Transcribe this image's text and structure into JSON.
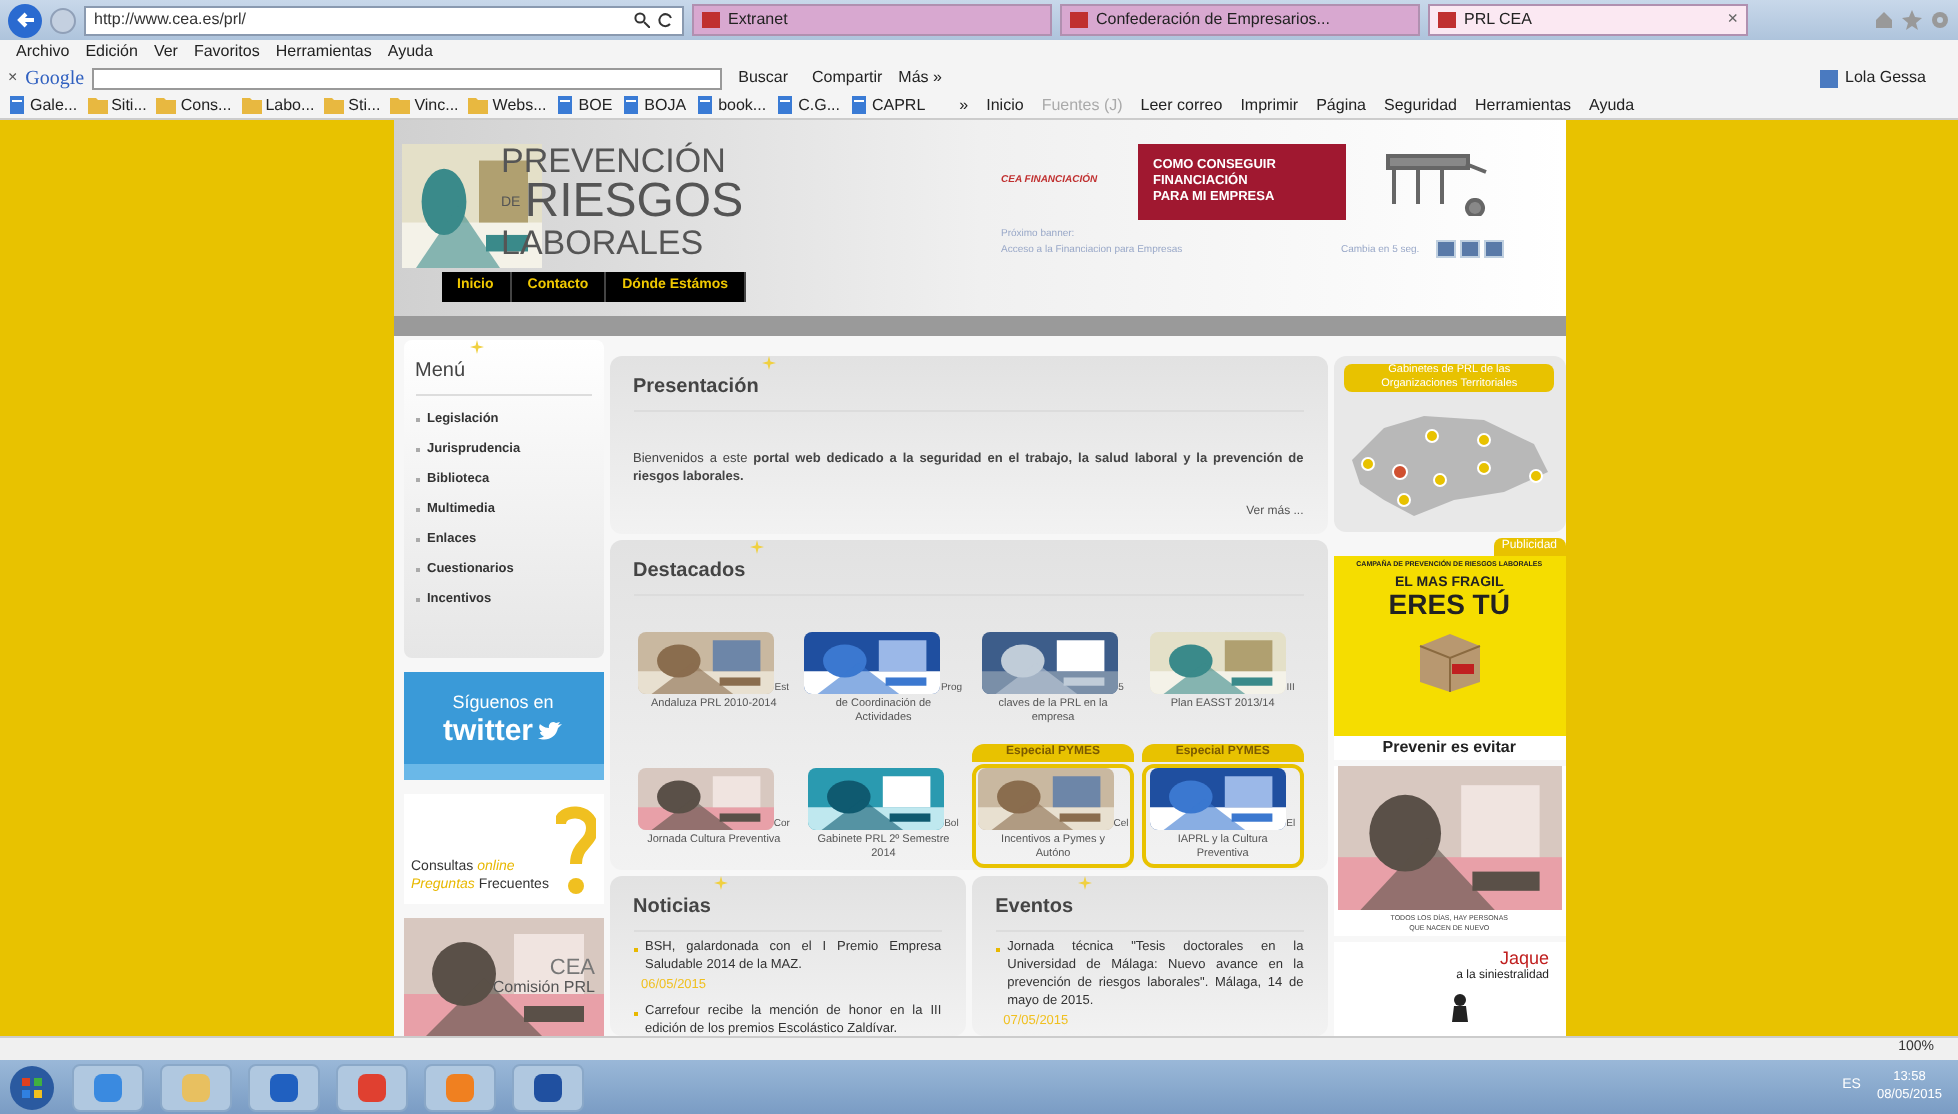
{
  "browser": {
    "address": "http://www.cea.es/prl/",
    "tabs": [
      {
        "label": "Extranet",
        "selected": false
      },
      {
        "label": "Confederación de Empresarios...",
        "selected": false
      },
      {
        "label": "PRL CEA",
        "selected": true,
        "close": "×"
      }
    ],
    "menu": [
      "Archivo",
      "Edición",
      "Ver",
      "Favoritos",
      "Herramientas",
      "Ayuda"
    ],
    "google_toolbar": {
      "close": "×",
      "logo": "Google",
      "buttons": [
        "Buscar",
        "Compartir"
      ],
      "more": "Más »",
      "user": "Lola Gessa"
    },
    "favorites": [
      {
        "label": "Gale...",
        "kind": "page"
      },
      {
        "label": "Siti...",
        "kind": "folder"
      },
      {
        "label": "Cons...",
        "kind": "folder"
      },
      {
        "label": "Labo...",
        "kind": "folder"
      },
      {
        "label": "Sti...",
        "kind": "folder"
      },
      {
        "label": "Vinc...",
        "kind": "folder"
      },
      {
        "label": "Webs...",
        "kind": "folder"
      },
      {
        "label": "BOE",
        "kind": "page"
      },
      {
        "label": "BOJA",
        "kind": "page"
      },
      {
        "label": "book...",
        "kind": "page"
      },
      {
        "label": "C.G...",
        "kind": "page"
      },
      {
        "label": "CAPRL",
        "kind": "page"
      }
    ],
    "favorites_more": "»",
    "commands": [
      {
        "label": "Inicio",
        "disabled": false
      },
      {
        "label": "Fuentes (J)",
        "disabled": true
      },
      {
        "label": "Leer correo",
        "disabled": false
      },
      {
        "label": "Imprimir",
        "disabled": false
      },
      {
        "label": "Página",
        "disabled": false
      },
      {
        "label": "Seguridad",
        "disabled": false
      },
      {
        "label": "Herramientas",
        "disabled": false
      },
      {
        "label": "Ayuda",
        "disabled": false
      }
    ]
  },
  "header": {
    "logo": [
      "PREVENCIÓN",
      "DE",
      "RIESGOS",
      "LABORALES"
    ],
    "nav": [
      "Inicio",
      "Contacto",
      "Dónde Estámos"
    ],
    "banner_brand": "CEA FINANCIACIÓN",
    "banner_lines": [
      "COMO CONSEGUIR",
      "FINANCIACIÓN",
      "PARA MI EMPRESA"
    ],
    "next_banner": [
      "Próximo banner:",
      "Acceso a la Financiacion para Empresas"
    ],
    "countdown": "Cambia en 5 seg."
  },
  "menu_box": {
    "title": "Menú",
    "items": [
      "Legislación",
      "Jurisprudencia",
      "Biblioteca",
      "Multimedia",
      "Enlaces",
      "Cuestionarios",
      "Incentivos"
    ]
  },
  "twitter": {
    "line": "Síguenos en",
    "brand": "twitter"
  },
  "faq": {
    "consultas": "Consultas",
    "online": "online",
    "preguntas": "Preguntas",
    "frecuentes": "Frecuentes"
  },
  "commission": {
    "lines": [
      "CEA",
      "Comisión PRL"
    ]
  },
  "presentation": {
    "title": "Presentación",
    "text": "Bienvenidos a este **portal web dedicado a la seguridad en el trabajo, la salud laboral y la prevención de riesgos laborales.**",
    "more": "Ver más ..."
  },
  "featured": {
    "title": "Destacados",
    "items": [
      {
        "caption": "Andaluza PRL 2010-2014",
        "overflow": "Est"
      },
      {
        "caption": "de Coordinación de Actividades",
        "overflow": "Prog"
      },
      {
        "caption": "claves de la PRL en la empresa",
        "overflow": "5"
      },
      {
        "caption": "Plan EASST 2013/14",
        "overflow": "III"
      },
      {
        "caption": "Jornada Cultura Preventiva",
        "overflow": "Cor"
      },
      {
        "caption": "Gabinete PRL 2º Semestre 2014",
        "overflow": "Bol"
      },
      {
        "caption": "Incentivos a Pymes y Autóno",
        "overflow": "Cel",
        "badge": "Especial PYMES"
      },
      {
        "caption": "IAPRL y la Cultura Preventiva",
        "overflow": "El",
        "badge": "Especial PYMES"
      }
    ]
  },
  "news": {
    "title": "Noticias",
    "items": [
      {
        "text": "BSH, galardonada con el I Premio Empresa Saludable 2014 de la MAZ.",
        "date": "06/05/2015"
      },
      {
        "text": "Carrefour recibe la mención de honor en la III edición de los premios Escolástico Zaldívar."
      }
    ]
  },
  "events": {
    "title": "Eventos",
    "items": [
      {
        "text": "Jornada técnica \"Tesis doctorales en la Universidad de Málaga: Nuevo avance en la prevención de riesgos laborales\". Málaga, 14 de mayo de 2015.",
        "date": "07/05/2015"
      }
    ]
  },
  "offices": {
    "title": "Gabinetes de PRL de las Organizaciones Territoriales"
  },
  "ad": {
    "label": "Publicidad",
    "campaign": "CAMPAÑA DE PREVENCIÓN DE RIESGOS LABORALES",
    "line1": "EL MAS FRAGIL",
    "line2": "ERES TÚ",
    "slogan": "Prevenir es evitar"
  },
  "baby_ad": {
    "caption": "TODOS LOS DÍAS, HAY PERSONAS QUE NACEN DE NUEVO"
  },
  "jaque": {
    "title": "Jaque",
    "subtitle": "a la siniestralidad"
  },
  "status_bar": {
    "zoom": "100%"
  },
  "taskbar": {
    "language": "ES",
    "time": "13:58",
    "date": "08/05/2015"
  }
}
